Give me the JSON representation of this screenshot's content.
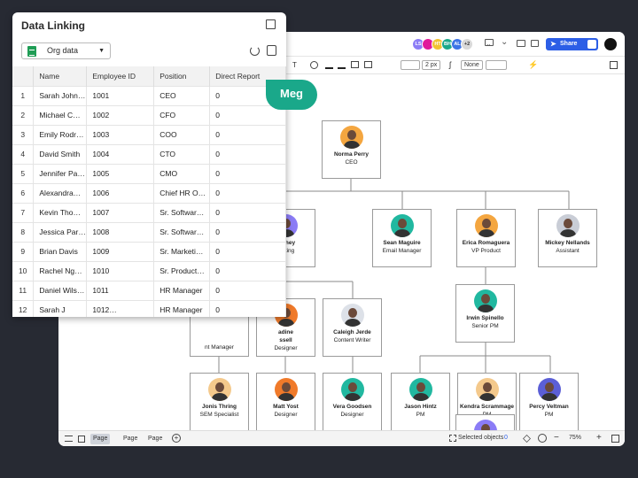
{
  "panel": {
    "title": "Data Linking",
    "source_label": "Org data",
    "columns": [
      "",
      "Name",
      "Employee ID",
      "Position",
      "Direct Report"
    ],
    "rows": [
      [
        "1",
        "Sarah John…",
        "1001",
        "CEO",
        "0"
      ],
      [
        "2",
        "Michael C…",
        "1002",
        "CFO",
        "0"
      ],
      [
        "3",
        "Emily Rodr…",
        "1003",
        "COO",
        "0"
      ],
      [
        "4",
        "David Smith",
        "1004",
        "CTO",
        "0"
      ],
      [
        "5",
        "Jennifer Pa…",
        "1005",
        "CMO",
        "0"
      ],
      [
        "6",
        "Alexandra…",
        "1006",
        "Chief HR O…",
        "0"
      ],
      [
        "7",
        "Kevin Tho…",
        "1007",
        "Sr. Softwar…",
        "0"
      ],
      [
        "8",
        "Jessica Par…",
        "1008",
        "Sr. Softwar…",
        "0"
      ],
      [
        "9",
        "Brian Davis",
        "1009",
        "Sr. Marketi…",
        "0"
      ],
      [
        "10",
        "Rachel Ng…",
        "1010",
        "Sr. Product…",
        "0"
      ],
      [
        "11",
        "Daniel Wils…",
        "1011",
        "HR Manager",
        "0"
      ],
      [
        "12",
        "Sarah J",
        "1012…",
        "HR Manager",
        "0"
      ]
    ]
  },
  "cursor_label": "Meg",
  "topbar": {
    "avatars": [
      {
        "text": "LS",
        "color": "#8b7cf6"
      },
      {
        "text": "",
        "color": "#e01a9a"
      },
      {
        "text": "HT",
        "color": "#f2c230"
      },
      {
        "text": "BH",
        "color": "#1aa88a"
      },
      {
        "text": "AL",
        "color": "#3c74e6"
      },
      {
        "text": "+2",
        "color": "#d9d9d9"
      }
    ],
    "share_label": "Share",
    "title_fragment": "f"
  },
  "toolbar": {
    "text_tool": "T",
    "stroke_width": "2 px",
    "arrow_style": "None"
  },
  "org": {
    "nodes": [
      {
        "name": "Norma Perry",
        "role": "CEO",
        "color": "#f4a640"
      },
      {
        "name": "Sean Maguire",
        "role": "Email Manager",
        "color": "#21b8a0"
      },
      {
        "name": "Erica Romaguera",
        "role": "VP Product",
        "color": "#f4a640"
      },
      {
        "name": "Mickey Nellands",
        "role": "Assistant",
        "color": "#c9cdd6"
      },
      {
        "name": "Caleigh Jerde",
        "role": "Content Writer",
        "color": "#dde1e8"
      },
      {
        "name": "Irwin Spinello",
        "role": "Senior PM",
        "color": "#21b8a0"
      },
      {
        "name": "Jonis Thring",
        "role": "SEM Specialist",
        "color": "#f4c98c"
      },
      {
        "name": "Matt Yost",
        "role": "Designer",
        "color": "#f07a2a"
      },
      {
        "name": "Vera Goodsen",
        "role": "Designer",
        "color": "#21b8a0"
      },
      {
        "name": "Jason Hintz",
        "role": "PM",
        "color": "#21b8a0"
      },
      {
        "name": "Kendra Scrammage",
        "role": "PM",
        "color": "#f4c98c"
      },
      {
        "name": "Percy Veltman",
        "role": "PM",
        "color": "#5b5fd6"
      }
    ],
    "partial": {
      "p1_name": "Withey",
      "p1_role": "rketing",
      "p2_name": "adine",
      "p2_name2": "ssell",
      "p2_role": "Designer",
      "p3_role": "nt Manager"
    }
  },
  "bottombar": {
    "pages": [
      "Page 1",
      "Page 2",
      "Page 3"
    ],
    "selected_label": "Selected objects",
    "selected_count": "0",
    "zoom": "75%"
  }
}
